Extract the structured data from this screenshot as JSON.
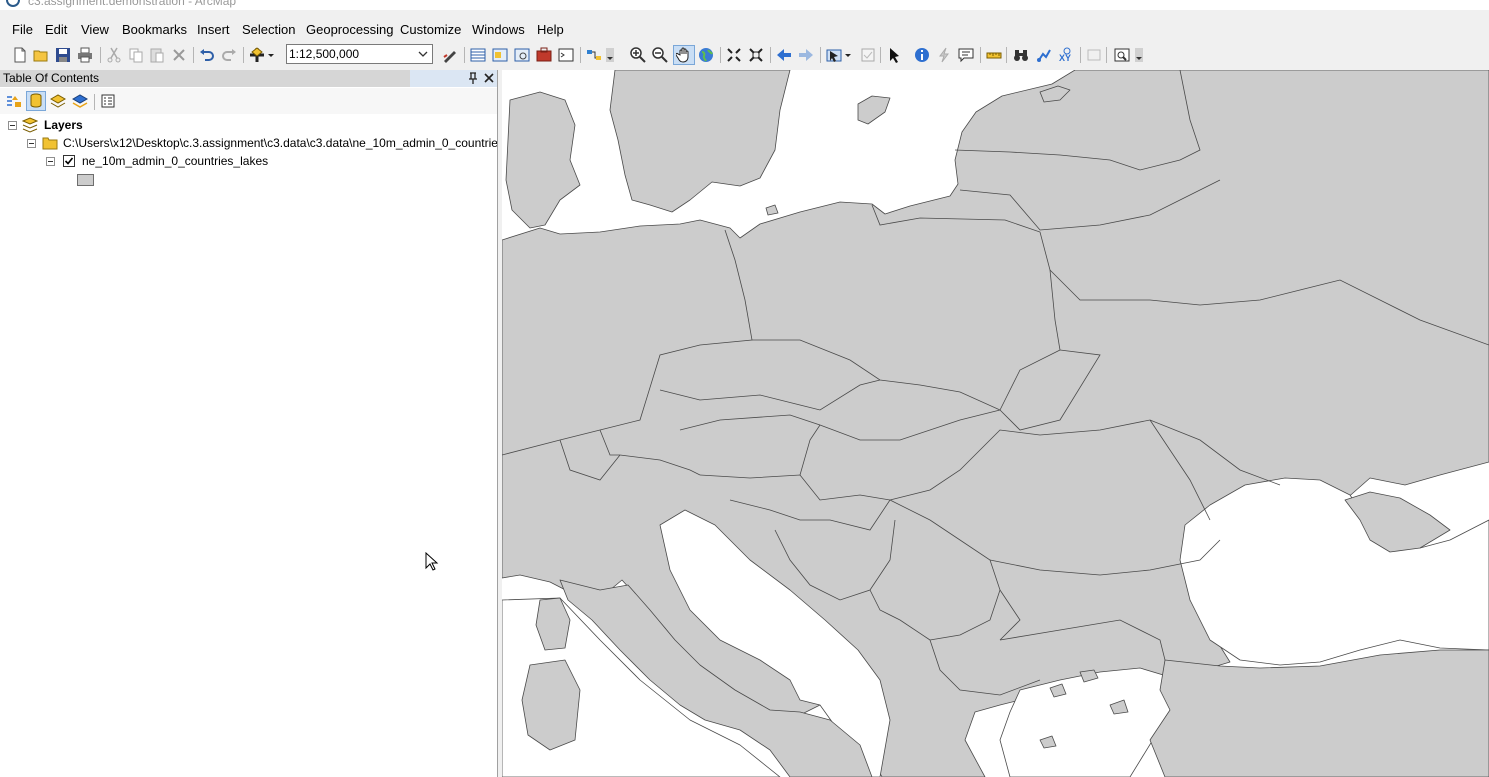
{
  "window": {
    "title": "c3.assignment.demonstration - ArcMap",
    "icon": "arcmap-app-icon"
  },
  "menu": [
    "File",
    "Edit",
    "View",
    "Bookmarks",
    "Insert",
    "Selection",
    "Geoprocessing",
    "Customize",
    "Windows",
    "Help"
  ],
  "toolbar": {
    "scale_value": "1:12,500,000"
  },
  "toc": {
    "title": "Table Of Contents",
    "root_label": "Layers",
    "folder_label": "C:\\Users\\x12\\Desktop\\c.3.assignment\\c3.data\\c3.data\\ne_10m_admin_0_countrie",
    "layer_label": "ne_10m_admin_0_countries_lakes",
    "layer_checked": true
  },
  "colors": {
    "land": "#cccccc",
    "water": "#ffffff",
    "border": "#4a4a4a",
    "accent": "#c9def5"
  }
}
